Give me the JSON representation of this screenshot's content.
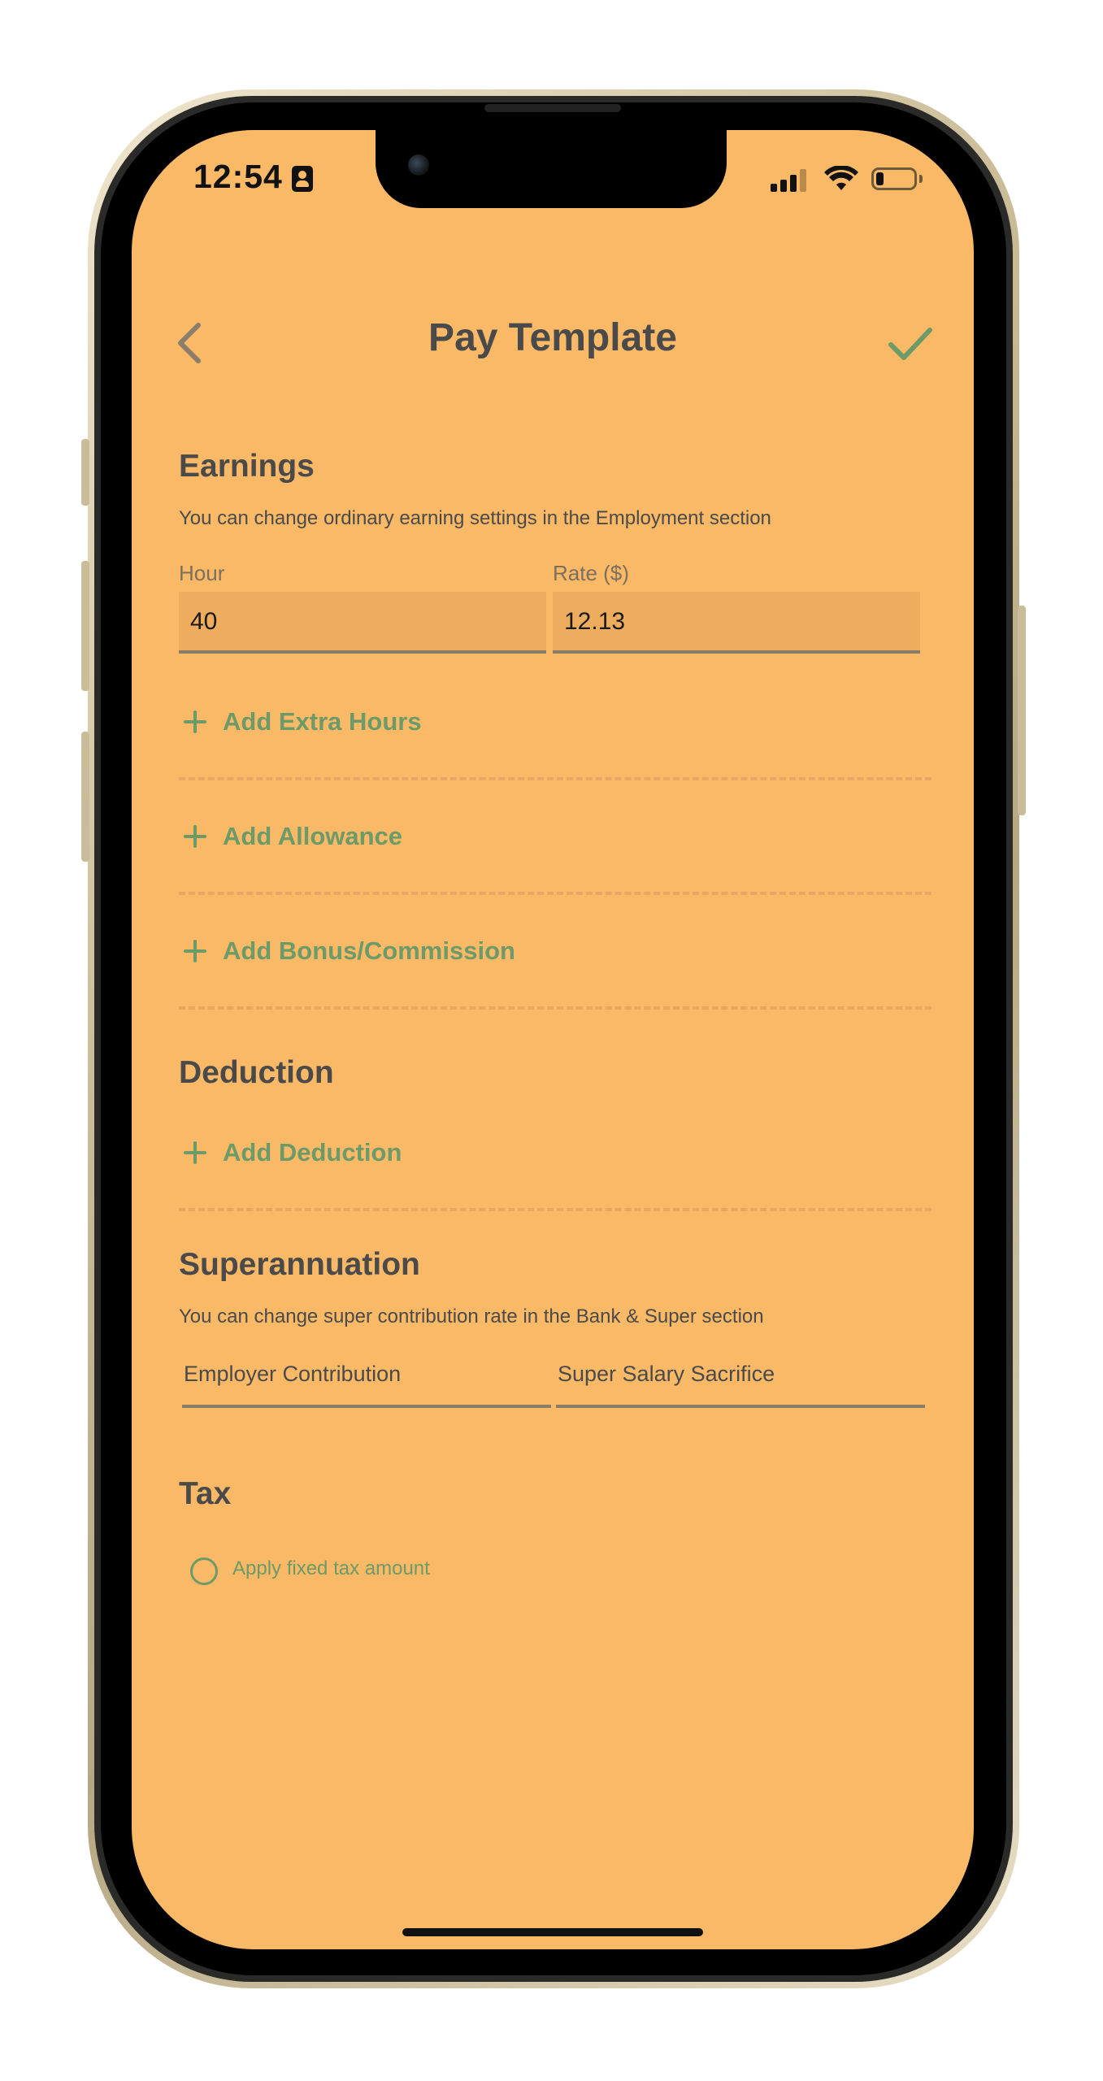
{
  "status_bar": {
    "time": "12:54"
  },
  "nav": {
    "title": "Pay Template"
  },
  "earnings": {
    "title": "Earnings",
    "subtitle": "You can change ordinary earning settings in the Employment section",
    "hour_label": "Hour",
    "hour_value": "40",
    "rate_label": "Rate ($)",
    "rate_value": "12.13",
    "add_extra_hours": "Add Extra Hours",
    "add_allowance": "Add Allowance",
    "add_bonus": "Add Bonus/Commission"
  },
  "deduction": {
    "title": "Deduction",
    "add_deduction": "Add Deduction"
  },
  "superannuation": {
    "title": "Superannuation",
    "subtitle": "You can change super contribution rate in the Bank & Super section",
    "employer_placeholder": "Employer Contribution",
    "sacrifice_placeholder": "Super Salary Sacrifice"
  },
  "tax": {
    "title": "Tax",
    "fixed_tax_label": "Apply fixed tax amount",
    "fixed_tax_checked": false
  },
  "colors": {
    "background": "#fab966",
    "accent": "#6c9a68",
    "text": "#4a4a4a"
  },
  "icons": [
    "contact-card-icon",
    "cellular-signal-icon",
    "wifi-icon",
    "battery-icon",
    "chevron-left-icon",
    "checkmark-icon",
    "plus-icon"
  ]
}
